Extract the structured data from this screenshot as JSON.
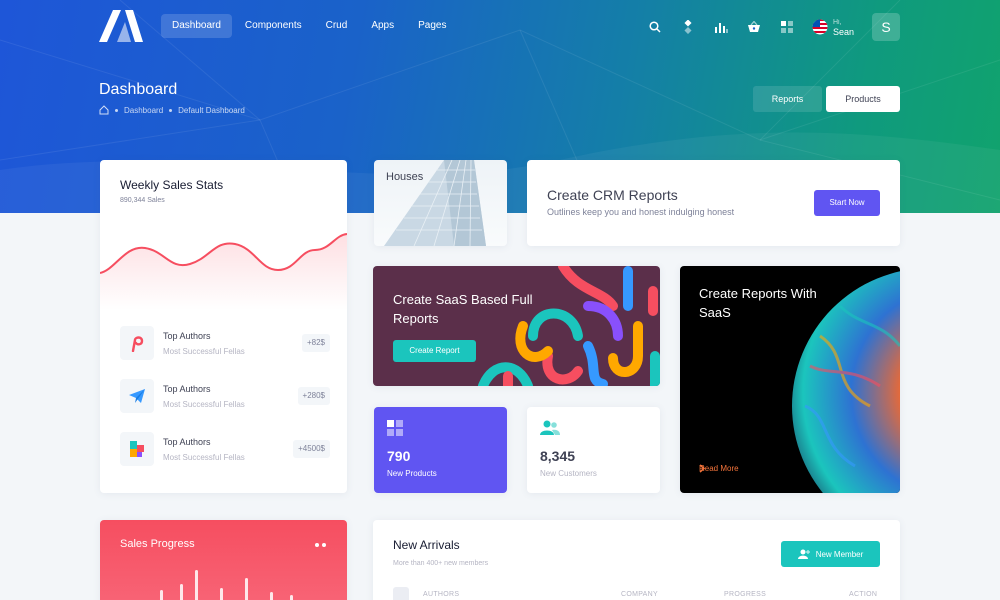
{
  "nav": {
    "items": [
      {
        "label": "Dashboard",
        "active": true
      },
      {
        "label": "Components",
        "active": false
      },
      {
        "label": "Crud",
        "active": false
      },
      {
        "label": "Apps",
        "active": false
      },
      {
        "label": "Pages",
        "active": false
      }
    ]
  },
  "topbar": {
    "icons": [
      "search-icon",
      "layers-icon",
      "chart-bars-icon",
      "basket-icon",
      "apps-grid-icon",
      "us-flag-icon"
    ],
    "user_greeting": "Hi,",
    "user_name": "Sean",
    "user_initial": "S"
  },
  "header": {
    "title": "Dashboard",
    "breadcrumb": [
      "Dashboard",
      "Default Dashboard"
    ],
    "reports_label": "Reports",
    "products_label": "Products"
  },
  "weekly": {
    "title": "Weekly Sales Stats",
    "subtitle": "890,344 Sales",
    "authors": [
      {
        "name": "Top Authors",
        "desc": "Most Successful Fellas",
        "value": "+82$",
        "icon": "pinterest-icon"
      },
      {
        "name": "Top Authors",
        "desc": "Most Successful Fellas",
        "value": "+280$",
        "icon": "telegram-icon"
      },
      {
        "name": "Top Authors",
        "desc": "Most Successful Fellas",
        "value": "+4500$",
        "icon": "puzzle-icon"
      }
    ]
  },
  "houses": {
    "label": "Houses"
  },
  "crm": {
    "title": "Create CRM Reports",
    "subtitle": "Outlines keep you and honest indulging honest",
    "button": "Start Now"
  },
  "saas": {
    "title": "Create SaaS Based Full Reports",
    "button": "Create Report"
  },
  "space": {
    "title": "Create Reports With SaaS",
    "link": "Read More"
  },
  "stats": {
    "products": {
      "value": "790",
      "label": "New Products"
    },
    "customers": {
      "value": "8,345",
      "label": "New Customers"
    }
  },
  "sales_progress": {
    "title": "Sales Progress"
  },
  "arrivals": {
    "title": "New Arrivals",
    "subtitle": "More than 400+ new members",
    "button": "New Member",
    "columns": [
      "AUTHORS",
      "COMPANY",
      "PROGRESS",
      "ACTION"
    ]
  },
  "colors": {
    "primary": "#6055f2",
    "success": "#1bc5bd",
    "danger": "#f64e60",
    "warning": "#f4743b"
  }
}
